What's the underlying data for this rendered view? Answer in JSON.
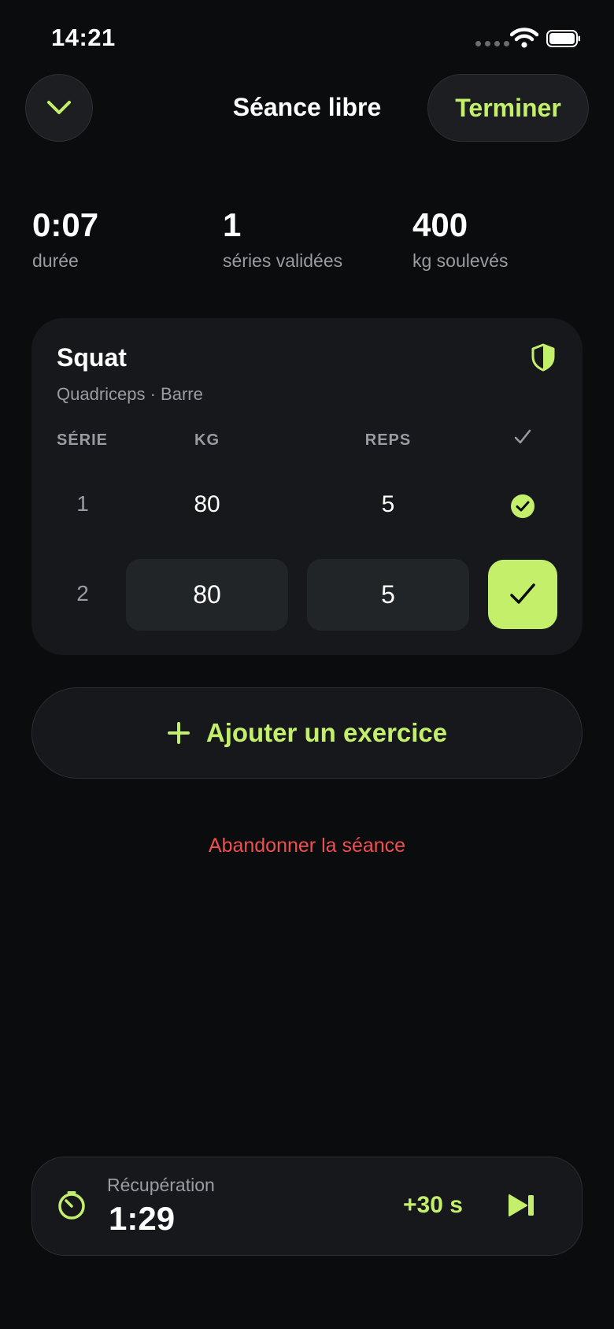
{
  "status_bar": {
    "time": "14:21"
  },
  "header": {
    "title": "Séance libre",
    "finish_label": "Terminer"
  },
  "stats": [
    {
      "value": "0:07",
      "label": "durée"
    },
    {
      "value": "1",
      "label": "séries validées"
    },
    {
      "value": "400",
      "label": "kg soulevés"
    }
  ],
  "exercise": {
    "name": "Squat",
    "subtitle": "Quadriceps · Barre",
    "columns": {
      "set": "SÉRIE",
      "kg": "KG",
      "reps": "REPS"
    },
    "sets": [
      {
        "number": "1",
        "kg": "80",
        "reps": "5",
        "done": true
      },
      {
        "number": "2",
        "kg": "80",
        "reps": "5",
        "done": false
      }
    ]
  },
  "actions": {
    "add_exercise_label": "Ajouter un exercice",
    "abandon_label": "Abandonner la séance"
  },
  "rest_timer": {
    "label": "Récupération",
    "time": "1:29",
    "add_label": "+30 s"
  },
  "colors": {
    "accent": "#c4ef6b",
    "danger": "#ef4f4f",
    "background": "#0b0c0e",
    "card": "#17181b"
  },
  "icons": {
    "collapse": "chevron-down-icon",
    "shield": "shield-icon",
    "check": "checkmark-icon",
    "check_circle": "check-circle-icon",
    "plus": "plus-icon",
    "timer": "timer-icon",
    "skip": "skip-forward-icon"
  }
}
